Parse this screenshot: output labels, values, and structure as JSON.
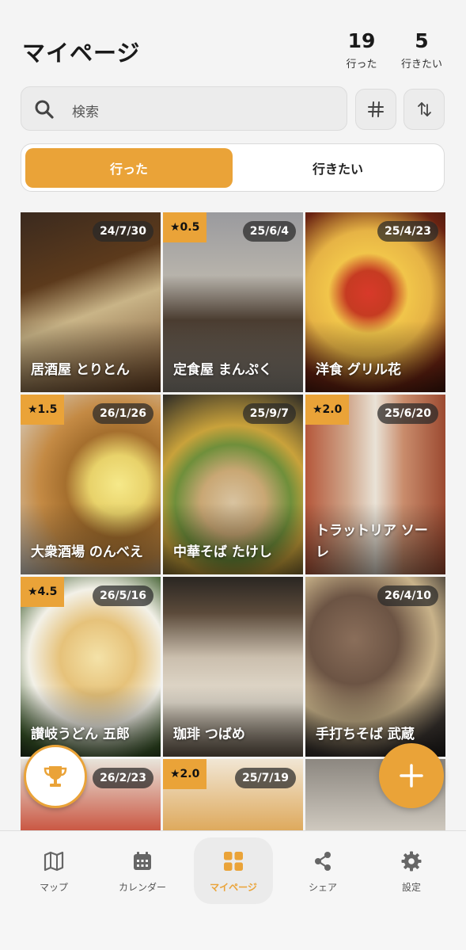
{
  "header": {
    "title": "マイページ",
    "stats": [
      {
        "value": "19",
        "label": "行った"
      },
      {
        "value": "5",
        "label": "行きたい"
      }
    ]
  },
  "search": {
    "placeholder": "検索"
  },
  "segment": {
    "tabs": [
      "行った",
      "行きたい"
    ],
    "active_index": 0
  },
  "accent_color": "#eaa338",
  "places": [
    {
      "name": "居酒屋 とりとん",
      "date": "24/7/30",
      "rating": ""
    },
    {
      "name": "定食屋 まんぷく",
      "date": "25/6/4",
      "rating": "★0.5"
    },
    {
      "name": "洋食 グリル花",
      "date": "25/4/23",
      "rating": ""
    },
    {
      "name": "大衆酒場 のんべえ",
      "date": "26/1/26",
      "rating": "★1.5"
    },
    {
      "name": "中華そば たけし",
      "date": "25/9/7",
      "rating": ""
    },
    {
      "name": "トラットリア ソーレ",
      "date": "25/6/20",
      "rating": "★2.0"
    },
    {
      "name": "讃岐うどん 五郎",
      "date": "26/5/16",
      "rating": "★4.5"
    },
    {
      "name": "珈琲 つばめ",
      "date": "",
      "rating": ""
    },
    {
      "name": "手打ちそば 武蔵",
      "date": "26/4/10",
      "rating": ""
    },
    {
      "name": "",
      "date": "26/2/23",
      "rating": ""
    },
    {
      "name": "",
      "date": "25/7/19",
      "rating": "★2.0"
    },
    {
      "name": "",
      "date": "",
      "rating": ""
    }
  ],
  "fab": {
    "left_icon": "trophy-icon",
    "right_icon": "plus-icon"
  },
  "tabbar": [
    {
      "label": "マップ",
      "icon": "map-icon"
    },
    {
      "label": "カレンダー",
      "icon": "calendar-icon"
    },
    {
      "label": "マイページ",
      "icon": "grid-icon",
      "active": true
    },
    {
      "label": "シェア",
      "icon": "share-icon"
    },
    {
      "label": "設定",
      "icon": "gear-icon"
    }
  ]
}
